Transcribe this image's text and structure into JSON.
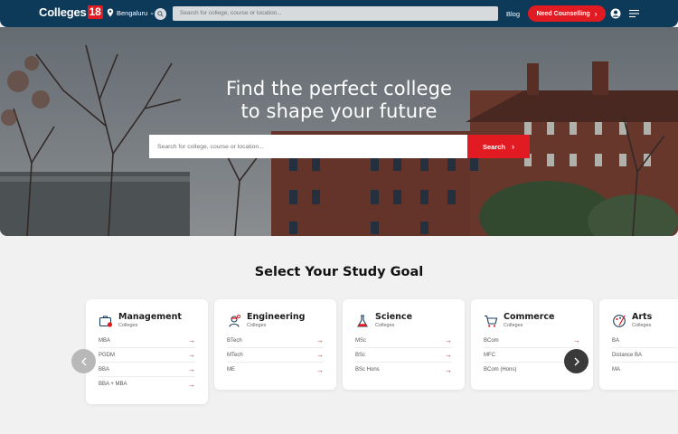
{
  "header": {
    "logo_text": "Colleges",
    "logo_num": "18",
    "location": "Bengaluru",
    "search_placeholder": "Search for college, course or location...",
    "blog_label": "Blog",
    "counselling_label": "Need Counselling",
    "bg_color": "#0e3a5a",
    "accent_color": "#e21b22"
  },
  "hero": {
    "title_line1": "Find the perfect college",
    "title_line2": "to shape your future",
    "search_placeholder": "Search for college, course or location...",
    "search_button": "Search"
  },
  "goals": {
    "title": "Select Your Study Goal",
    "cards": [
      {
        "name": "Management",
        "sub": "Colleges",
        "icon": "briefcase-icon",
        "items": [
          "MBA",
          "PGDM",
          "BBA",
          "BBA + MBA"
        ]
      },
      {
        "name": "Engineering",
        "sub": "Colleges",
        "icon": "engineer-icon",
        "items": [
          "BTech",
          "MTech",
          "ME"
        ]
      },
      {
        "name": "Science",
        "sub": "Colleges",
        "icon": "flask-icon",
        "items": [
          "MSc",
          "BSc",
          "BSc Hons"
        ]
      },
      {
        "name": "Commerce",
        "sub": "Colleges",
        "icon": "cart-icon",
        "items": [
          "BCom",
          "MFC",
          "BCom (Hons)"
        ]
      },
      {
        "name": "Arts",
        "sub": "Colleges",
        "icon": "palette-icon",
        "items": [
          "BA",
          "Distance BA",
          "MA"
        ]
      }
    ]
  }
}
